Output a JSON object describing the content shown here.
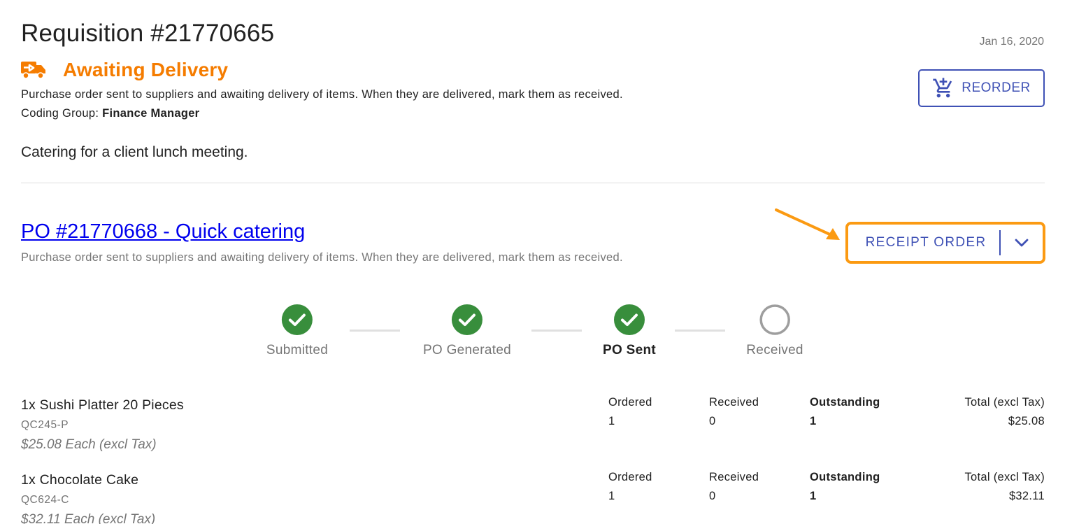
{
  "requisition": {
    "title": "Requisition #21770665",
    "date": "Jan 16, 2020",
    "status": {
      "icon": "truck-delivery-icon",
      "label": "Awaiting Delivery",
      "color": "#f57c00",
      "description": "Purchase order sent to suppliers and awaiting delivery of items. When they are delivered, mark them as received."
    },
    "coding_group_label": "Coding Group: ",
    "coding_group_value": "Finance Manager",
    "description": "Catering for a client lunch meeting.",
    "reorder_button": {
      "label": "REORDER",
      "icon": "cart-plus-icon"
    }
  },
  "purchase_order": {
    "link": "PO #21770668 - Quick catering",
    "description": "Purchase order sent to suppliers and awaiting delivery of items. When they are delivered, mark them as received.",
    "receipt_button": {
      "label": "RECEIPT ORDER",
      "dropdown_icon": "chevron-down-icon"
    },
    "highlight_color": "#fb9a12",
    "steps": [
      {
        "label": "Submitted",
        "state": "complete"
      },
      {
        "label": "PO Generated",
        "state": "complete"
      },
      {
        "label": "PO Sent",
        "state": "current"
      },
      {
        "label": "Received",
        "state": "pending"
      }
    ],
    "columns": {
      "ordered": "Ordered",
      "received": "Received",
      "outstanding": "Outstanding",
      "total": "Total (excl Tax)"
    },
    "items": [
      {
        "name": "1x Sushi Platter 20 Pieces",
        "sku": "QC245-P",
        "unit_price": "$25.08 Each (excl Tax)",
        "ordered": "1",
        "received": "0",
        "outstanding": "1",
        "total": "$25.08"
      },
      {
        "name": "1x Chocolate Cake",
        "sku": "QC624-C",
        "unit_price": "$32.11 Each (excl Tax)",
        "ordered": "1",
        "received": "0",
        "outstanding": "1",
        "total": "$32.11"
      }
    ]
  },
  "colors": {
    "primary": "#3f51b5",
    "success": "#388e3c",
    "pending": "#9e9e9e"
  }
}
